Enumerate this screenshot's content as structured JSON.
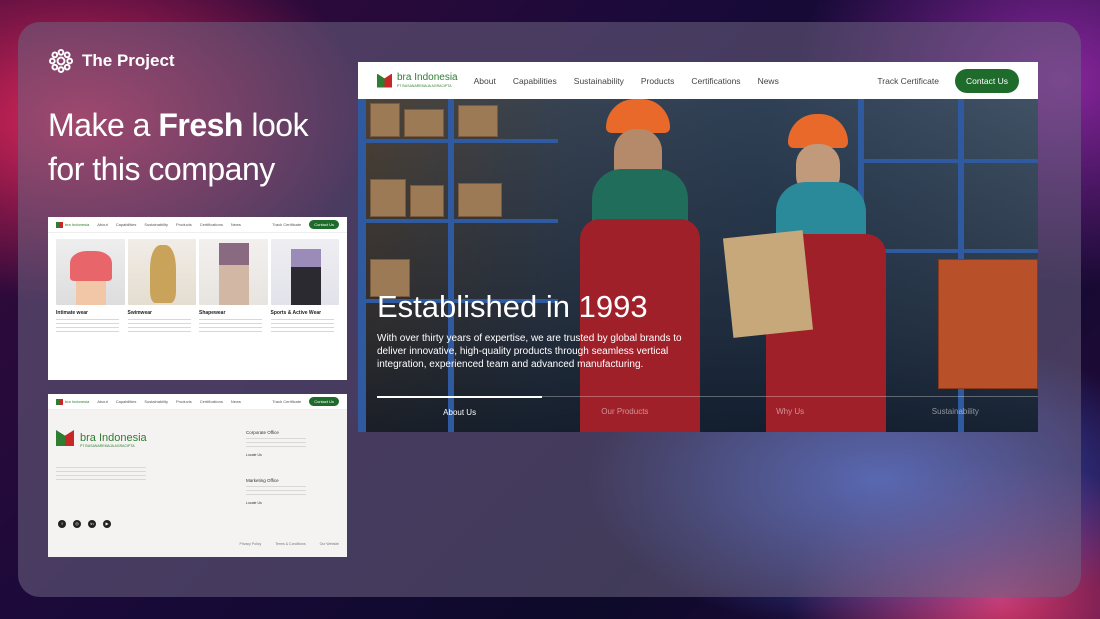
{
  "slide": {
    "brand": "The Project",
    "headline_pre": "Make a ",
    "headline_bold": "Fresh",
    "headline_post": " look",
    "headline_line2": "for this company"
  },
  "site": {
    "logo_name": "bra Indonesia",
    "logo_sub": "PT BUSANAREMAJA AGRACIPTA",
    "nav": [
      "About",
      "Capabilities",
      "Sustainability",
      "Products",
      "Certifications",
      "News"
    ],
    "track": "Track Certificate",
    "contact": "Contact Us",
    "hero_title": "Established in 1993",
    "hero_text": "With over thirty years of expertise, we are trusted by global brands to deliver innovative, high-quality products through seamless vertical integration, experienced team and advanced manufacturing.",
    "tabs": [
      "About Us",
      "Our Products",
      "Why Us",
      "Sustainability"
    ]
  },
  "products": [
    {
      "title": "Intimate wear",
      "color": "#e8666a"
    },
    {
      "title": "Swimwear",
      "color": "#caa35a"
    },
    {
      "title": "Shapewear",
      "color": "#d2b8a4"
    },
    {
      "title": "Sports & Active Wear",
      "color": "#9a8bb8"
    }
  ],
  "footer": {
    "corporate": "Corporate Office",
    "marketing": "Marketing Office",
    "locate": "Locate Us",
    "bottom_links": [
      "Privacy Policy",
      "Terms & Conditions",
      "Our Website"
    ]
  },
  "colors": {
    "brand_green": "#1f6b2c",
    "brand_red": "#c62828"
  }
}
